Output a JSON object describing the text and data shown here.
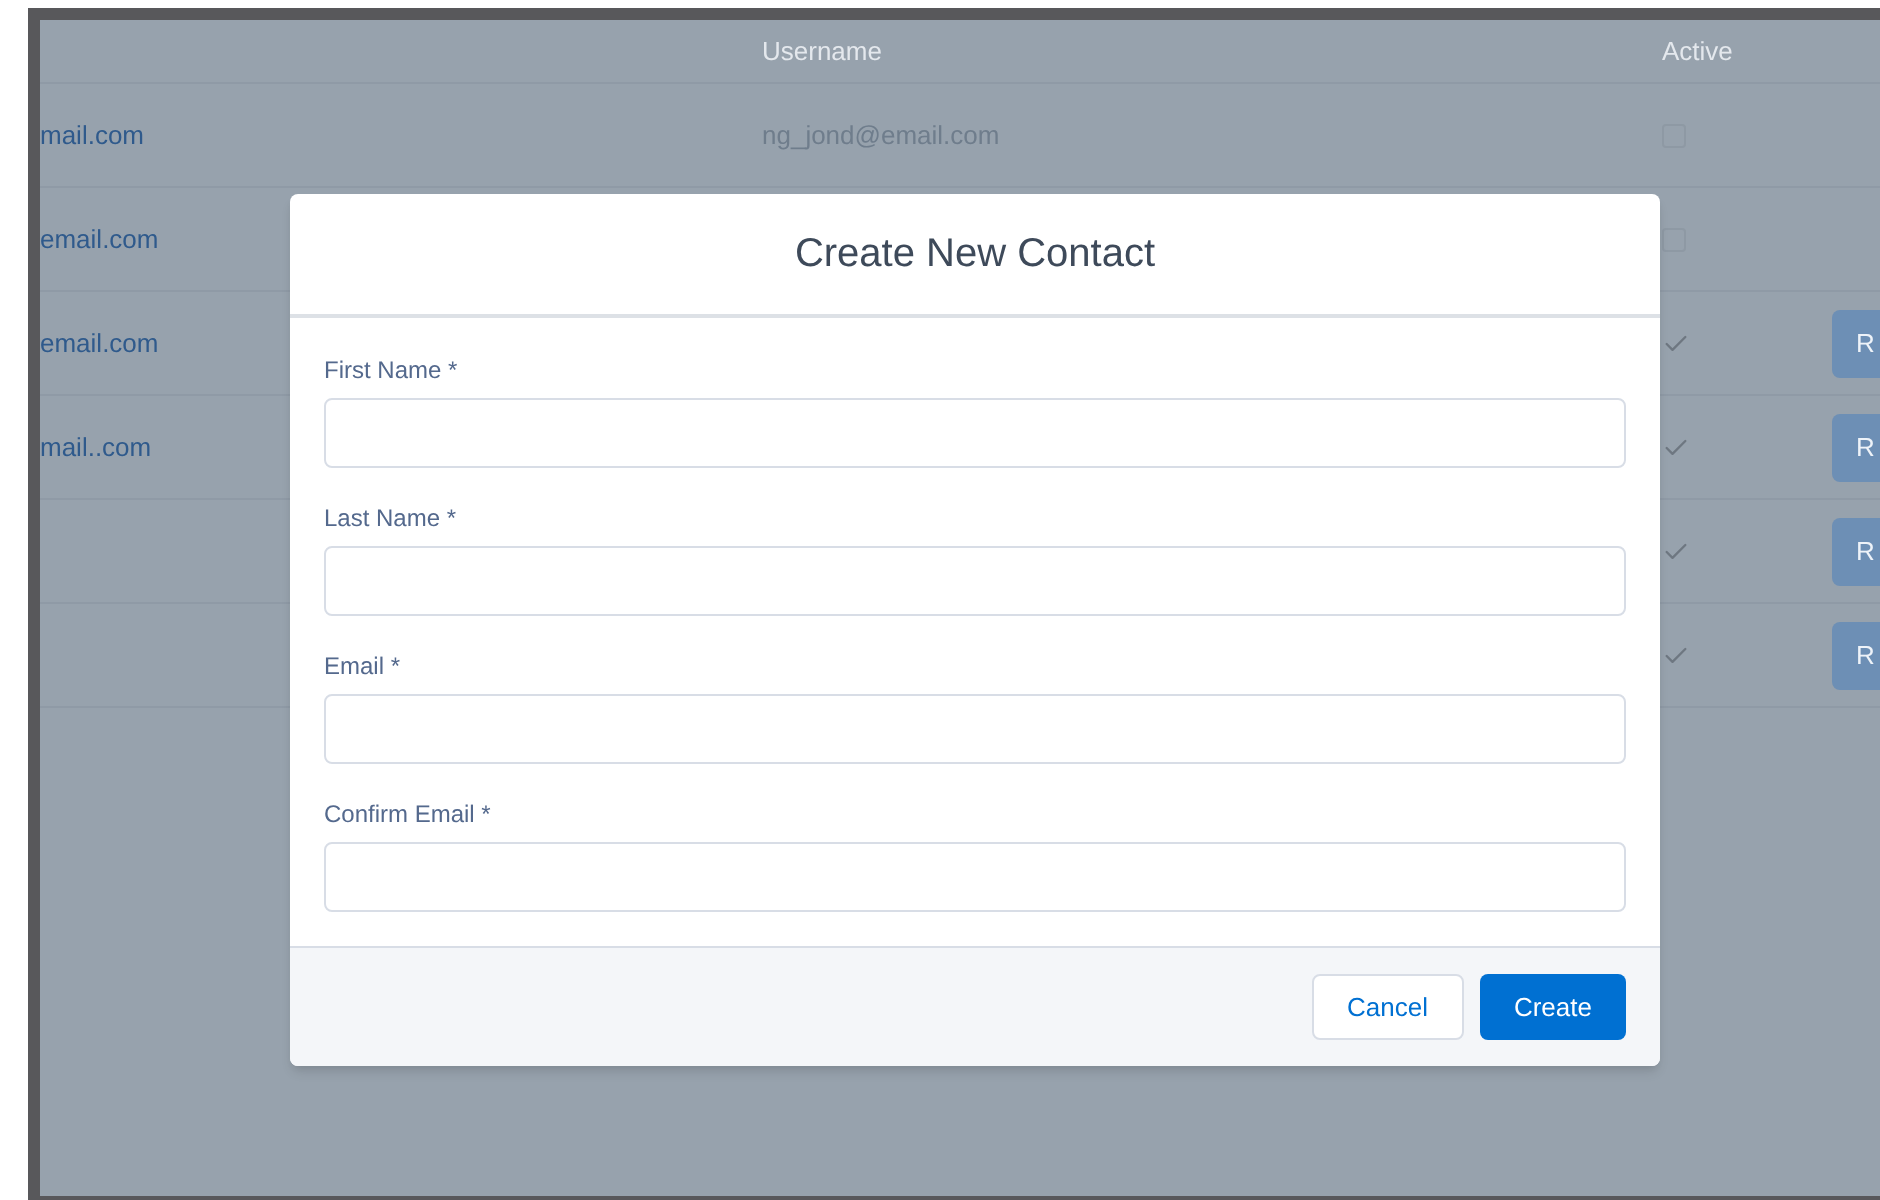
{
  "table": {
    "columns": [
      "Username",
      "Active"
    ],
    "rows": [
      {
        "email": "mail.com",
        "username": "ng_jond@email.com",
        "active": false
      },
      {
        "email": "email.com",
        "active": false
      },
      {
        "email": "email.com",
        "active": true,
        "button": "R"
      },
      {
        "email": "mail..com",
        "active": true,
        "button": "R"
      },
      {
        "active": true,
        "button": "R"
      },
      {
        "active": true,
        "button": "R"
      }
    ]
  },
  "modal": {
    "title": "Create New Contact",
    "fields": [
      {
        "label": "First Name *"
      },
      {
        "label": "Last Name *"
      },
      {
        "label": "Email *"
      },
      {
        "label": "Confirm Email *"
      }
    ],
    "buttons": [
      {
        "label": "Cancel",
        "kind": "secondary"
      },
      {
        "label": "Create",
        "kind": "primary"
      }
    ]
  }
}
